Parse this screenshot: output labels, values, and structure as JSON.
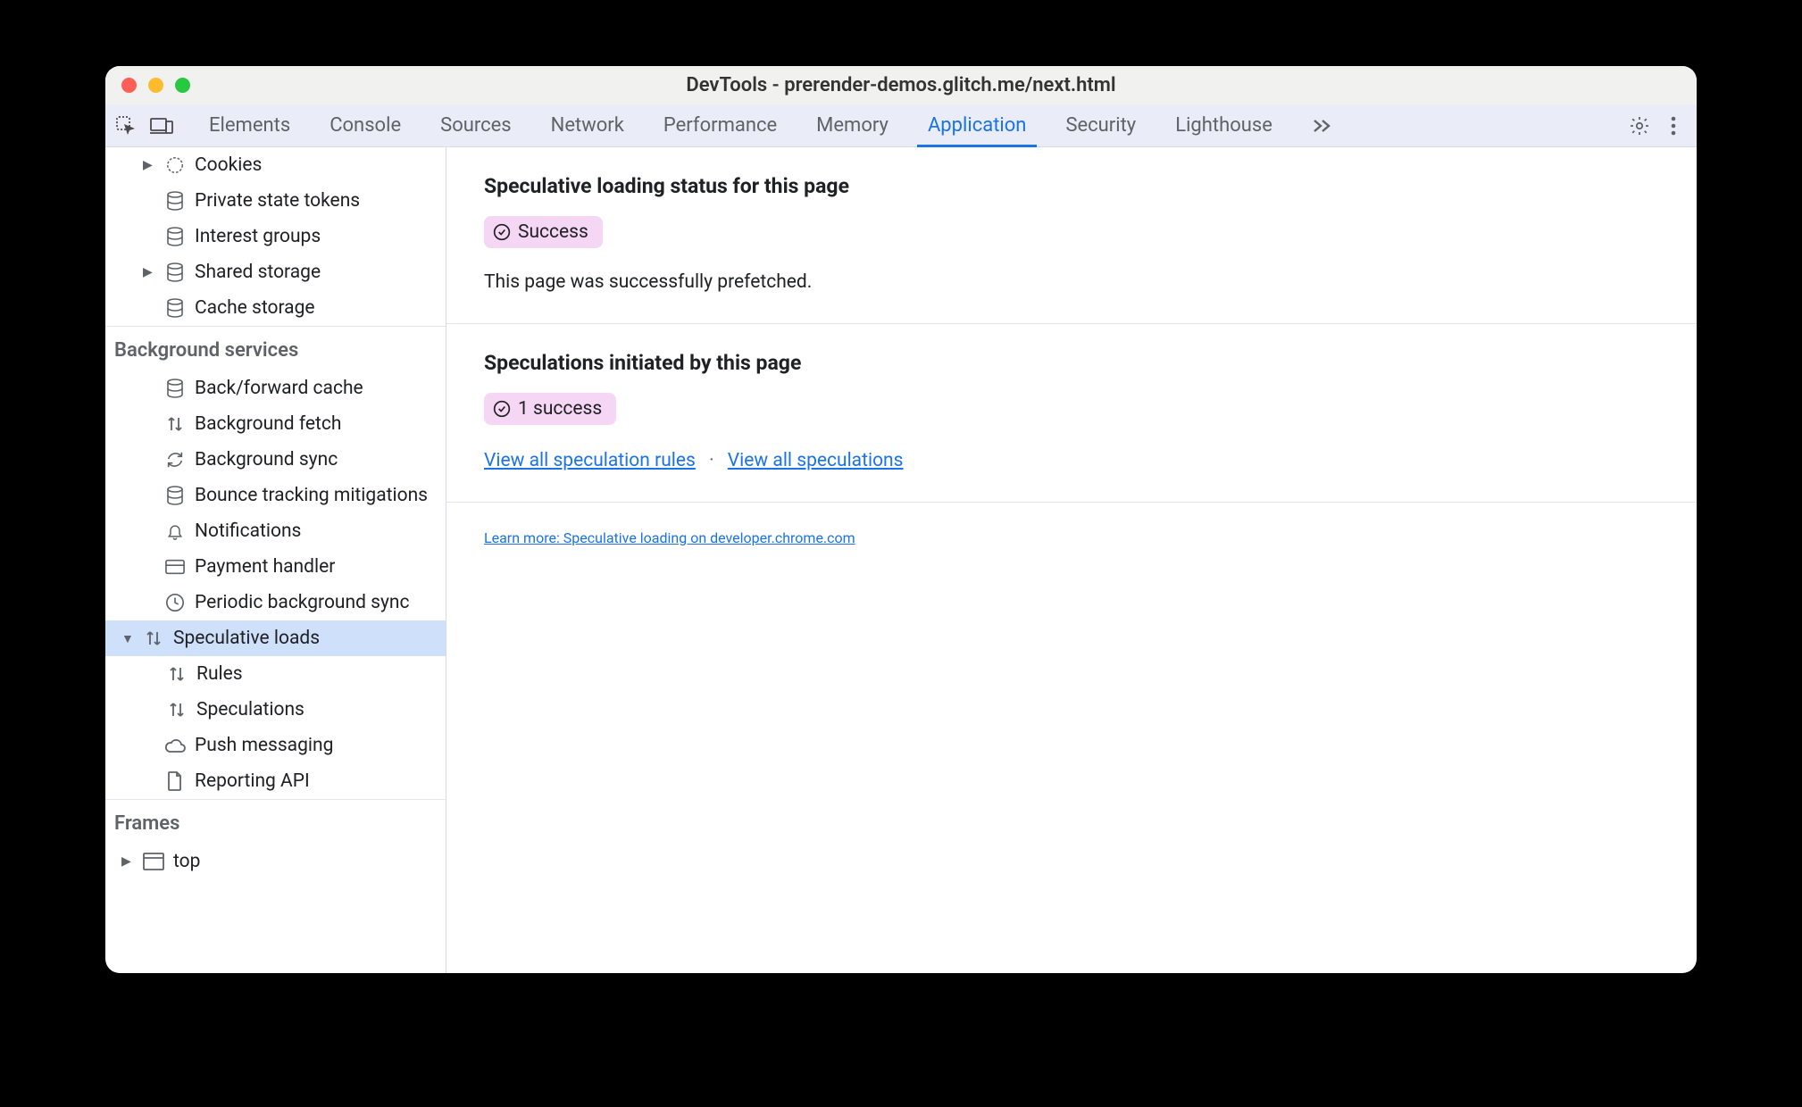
{
  "window_title": "DevTools - prerender-demos.glitch.me/next.html",
  "tabs": {
    "elements": "Elements",
    "console": "Console",
    "sources": "Sources",
    "network": "Network",
    "performance": "Performance",
    "memory": "Memory",
    "application": "Application",
    "security": "Security",
    "lighthouse": "Lighthouse"
  },
  "sidebar": {
    "storage": {
      "cookies": "Cookies",
      "private_state_tokens": "Private state tokens",
      "interest_groups": "Interest groups",
      "shared_storage": "Shared storage",
      "cache_storage": "Cache storage"
    },
    "bg_services_label": "Background services",
    "bg_services": {
      "bf_cache": "Back/forward cache",
      "bg_fetch": "Background fetch",
      "bg_sync": "Background sync",
      "bounce": "Bounce tracking mitigations",
      "notifications": "Notifications",
      "payment": "Payment handler",
      "periodic_sync": "Periodic background sync",
      "speculative_loads": "Speculative loads",
      "rules": "Rules",
      "speculations": "Speculations",
      "push": "Push messaging",
      "reporting": "Reporting API"
    },
    "frames_label": "Frames",
    "frames": {
      "top": "top"
    }
  },
  "main": {
    "status_heading": "Speculative loading status for this page",
    "status_badge": "Success",
    "status_text": "This page was successfully prefetched.",
    "initiated_heading": "Speculations initiated by this page",
    "initiated_badge": "1 success",
    "view_rules": "View all speculation rules",
    "view_speculations": "View all speculations",
    "learn_more": "Learn more: Speculative loading on developer.chrome.com"
  }
}
